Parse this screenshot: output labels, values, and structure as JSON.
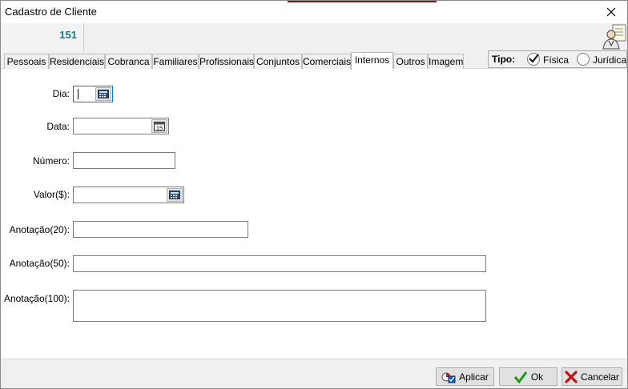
{
  "window": {
    "title": "Cadastro de Cliente"
  },
  "header": {
    "code": "151"
  },
  "tabs": [
    {
      "label": "Pessoais"
    },
    {
      "label": "Residenciais"
    },
    {
      "label": "Cobranca"
    },
    {
      "label": "Familiares"
    },
    {
      "label": "Profissionais"
    },
    {
      "label": "Conjuntos"
    },
    {
      "label": "Comerciais"
    },
    {
      "label": "Internos"
    },
    {
      "label": "Outros"
    },
    {
      "label": "Imagem"
    }
  ],
  "active_tab": "Internos",
  "tipo": {
    "label": "Tipo:",
    "options": [
      {
        "label": "Física",
        "selected": true
      },
      {
        "label": "Jurídica",
        "selected": false
      }
    ]
  },
  "form": {
    "dia": {
      "label": "Dia:",
      "value": ""
    },
    "data": {
      "label": "Data:",
      "value": ""
    },
    "numero": {
      "label": "Número:",
      "value": ""
    },
    "valor": {
      "label": "Valor($):",
      "value": ""
    },
    "anotacao20": {
      "label": "Anotação(20):",
      "value": ""
    },
    "anotacao50": {
      "label": "Anotação(50):",
      "value": ""
    },
    "anotacao100": {
      "label": "Anotação(100):",
      "value": ""
    }
  },
  "footer": {
    "apply_label": "Aplicar",
    "ok_label": "Ok",
    "cancel_label": "Cancelar"
  },
  "icons": {
    "close": "close-icon",
    "person": "person-card-icon",
    "calculator": "calculator-icon",
    "calendar": "calendar-icon"
  },
  "colors": {
    "code": "#1a7a94",
    "accent_line": "#7a1f1f"
  }
}
